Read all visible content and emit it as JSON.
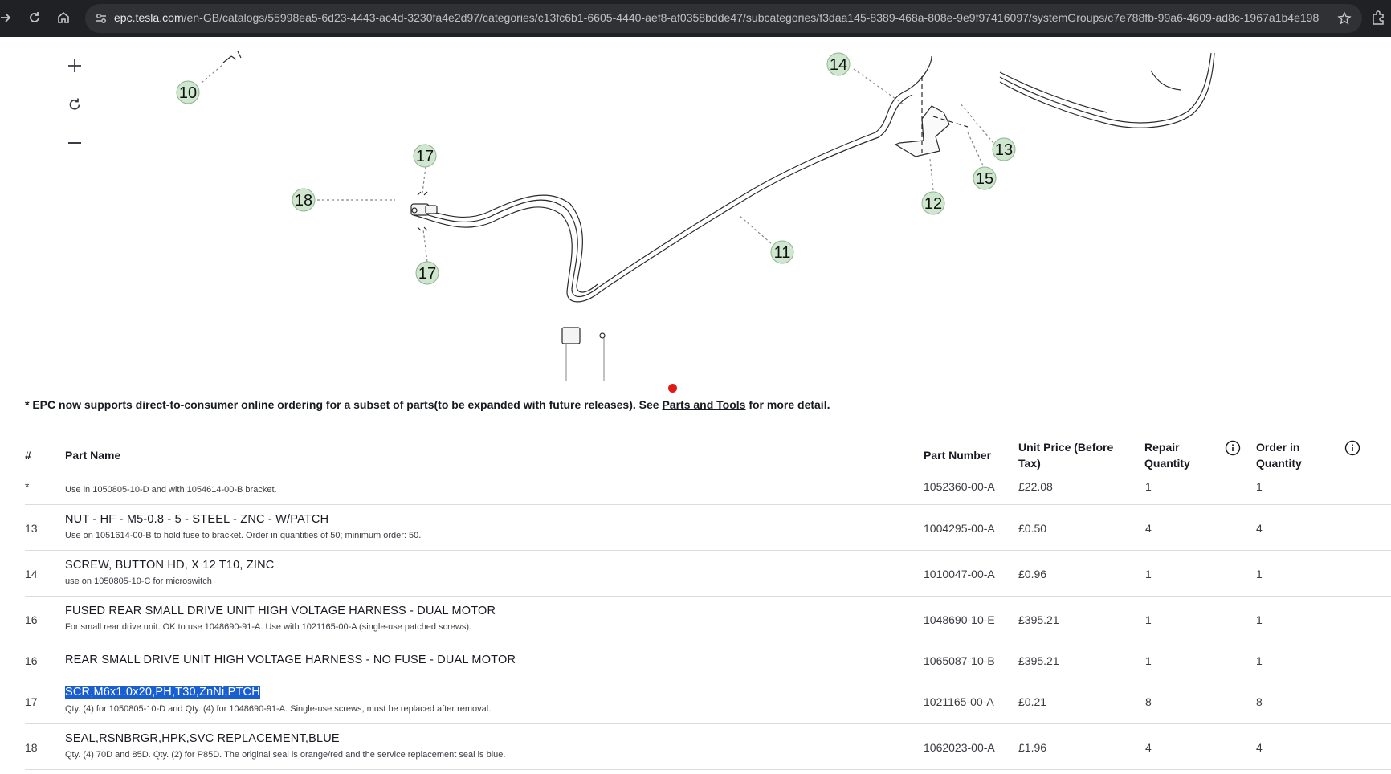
{
  "browser": {
    "url_host": "epc.tesla.com",
    "url_path": "/en-GB/catalogs/55998ea5-6d23-4443-ac4d-3230fa4e2d97/categories/c13fc6b1-6605-4440-aef8-af0358bdde47/subcategories/f3daa145-8389-468a-808e-9e9f97416097/systemGroups/c7e788fb-99a6-4609-ad8c-1967a1b4e198"
  },
  "diagram": {
    "controls": {
      "zoom_in": "+",
      "reset": "reset",
      "zoom_out": "−"
    },
    "callouts": [
      {
        "label": "10"
      },
      {
        "label": "14"
      },
      {
        "label": "13"
      },
      {
        "label": "15"
      },
      {
        "label": "12"
      },
      {
        "label": "17"
      },
      {
        "label": "18"
      },
      {
        "label": "17"
      },
      {
        "label": "11"
      }
    ]
  },
  "notice": {
    "text_before": "* EPC now supports direct-to-consumer online ordering for a subset of parts(to be expanded with future releases). See ",
    "link": "Parts and Tools",
    "text_after": " for more detail."
  },
  "table": {
    "headers": {
      "num": "#",
      "part_name": "Part Name",
      "part_number": "Part Number",
      "unit_price_1": "Unit Price (Before",
      "unit_price_2": "Tax)",
      "repair_qty_1": "Repair",
      "repair_qty_2": "Quantity",
      "order_qty_1": "Order in",
      "order_qty_2": "Quantity"
    },
    "rows": [
      {
        "num": "*",
        "name": "",
        "desc": "Use in 1050805-10-D and with 1054614-00-B bracket.",
        "part_number": "1052360-00-A",
        "price": "£22.08",
        "repair_qty": "1",
        "order_qty": "1"
      },
      {
        "num": "13",
        "name": "NUT - HF - M5-0.8 - 5 - STEEL - ZNC - W/PATCH",
        "desc": "Use on 1051614-00-B to hold fuse to bracket. Order in quantities of 50; minimum order: 50.",
        "part_number": "1004295-00-A",
        "price": "£0.50",
        "repair_qty": "4",
        "order_qty": "4"
      },
      {
        "num": "14",
        "name": "SCREW, BUTTON HD, X 12 T10, ZINC",
        "desc": "use on 1050805-10-C for microswitch",
        "part_number": "1010047-00-A",
        "price": "£0.96",
        "repair_qty": "1",
        "order_qty": "1"
      },
      {
        "num": "16",
        "name": "FUSED REAR SMALL DRIVE UNIT HIGH VOLTAGE HARNESS - DUAL MOTOR",
        "desc": "For small rear drive unit. OK to use 1048690-91-A. Use with 1021165-00-A (single-use patched screws).",
        "part_number": "1048690-10-E",
        "price": "£395.21",
        "repair_qty": "1",
        "order_qty": "1"
      },
      {
        "num": "16",
        "name": "REAR SMALL DRIVE UNIT HIGH VOLTAGE HARNESS - NO FUSE - DUAL MOTOR",
        "desc": "",
        "part_number": "1065087-10-B",
        "price": "£395.21",
        "repair_qty": "1",
        "order_qty": "1"
      },
      {
        "num": "17",
        "name": "SCR,M6x1.0x20,PH,T30,ZnNi,PTCH",
        "desc": "Qty. (4) for 1050805-10-D and Qty. (4) for 1048690-91-A. Single-use screws, must be replaced after removal.",
        "part_number": "1021165-00-A",
        "price": "£0.21",
        "repair_qty": "8",
        "order_qty": "8"
      },
      {
        "num": "18",
        "name": "SEAL,RSNBRGR,HPK,SVC REPLACEMENT,BLUE",
        "desc": "Qty. (4) 70D and 85D. Qty. (2) for P85D. The original seal is orange/red and the service replacement seal is blue.",
        "part_number": "1062023-00-A",
        "price": "£1.96",
        "repair_qty": "4",
        "order_qty": "4"
      }
    ]
  }
}
